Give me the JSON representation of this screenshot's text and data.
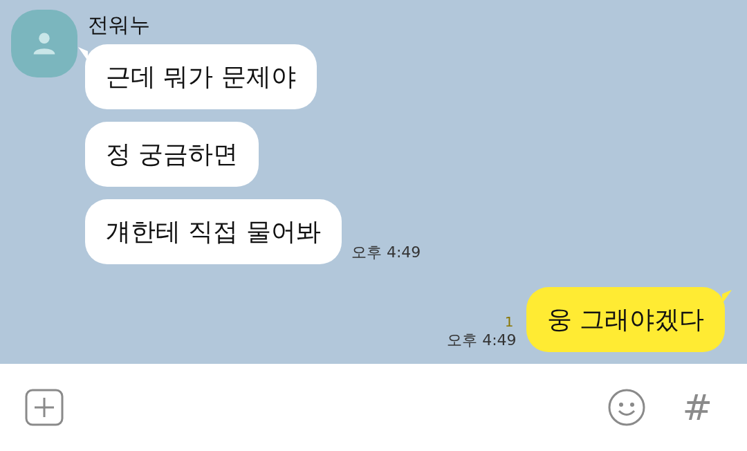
{
  "chat": {
    "sender": {
      "name": "전워누",
      "incoming": [
        {
          "text": "근데 뭐가 문제야"
        },
        {
          "text": "정 궁금하면"
        },
        {
          "text": "걔한테 직접 물어봐"
        }
      ],
      "time": "오후 4:49"
    },
    "outgoing": {
      "text": "웅 그래야겠다",
      "unread": "1",
      "time": "오후 4:49"
    }
  },
  "input_bar": {
    "hash": "#"
  }
}
